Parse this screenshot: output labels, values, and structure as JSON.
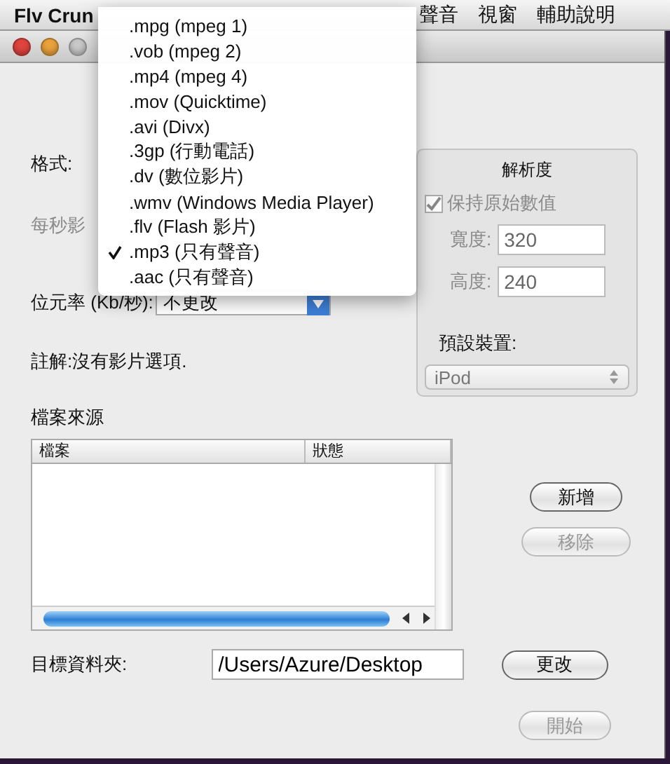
{
  "menu_bar": {
    "app_name": "Flv Crun",
    "items": [
      "聲音",
      "視窗",
      "輔助說明"
    ]
  },
  "format_menu": {
    "items": [
      {
        "label": ".mpg (mpeg 1)",
        "checked": false
      },
      {
        "label": ".vob (mpeg 2)",
        "checked": false
      },
      {
        "label": ".mp4 (mpeg 4)",
        "checked": false
      },
      {
        "label": ".mov (Quicktime)",
        "checked": false
      },
      {
        "label": ".avi (Divx)",
        "checked": false
      },
      {
        "label": ".3gp (行動電話)",
        "checked": false
      },
      {
        "label": ".dv (數位影片)",
        "checked": false
      },
      {
        "label": ".wmv (Windows Media Player)",
        "checked": false
      },
      {
        "label": ".flv (Flash 影片)",
        "checked": false
      },
      {
        "label": ".mp3 (只有聲音)",
        "checked": true
      },
      {
        "label": ".aac (只有聲音)",
        "checked": false
      }
    ]
  },
  "encoding": {
    "format_label": "格式:",
    "fps_label": {
      "text": "每秒影",
      "disabled": true
    },
    "bitrate": {
      "label": "位元率 (Kb/秒):",
      "value": "不更改"
    },
    "note": "註解:沒有影片選項."
  },
  "resolution": {
    "title": "解析度",
    "keep_original": {
      "label": "保持原始數值",
      "checked": true,
      "disabled": true
    },
    "width": {
      "label": "寬度:",
      "value": "320",
      "disabled": true
    },
    "height": {
      "label": "高度:",
      "value": "240",
      "disabled": true
    },
    "preset_label": "預設裝置:",
    "preset": {
      "value": "iPod",
      "disabled": true
    }
  },
  "source": {
    "title": "檔案來源",
    "columns": [
      "檔案",
      "狀態"
    ]
  },
  "source_buttons": [
    {
      "label": "新增",
      "disabled": false
    },
    {
      "label": "移除",
      "disabled": true
    }
  ],
  "destination": {
    "label": "目標資料夾:",
    "value": "/Users/Azure/Desktop",
    "button": {
      "label": "更改",
      "disabled": false
    }
  },
  "start_button": {
    "label": "開始",
    "disabled": true
  }
}
